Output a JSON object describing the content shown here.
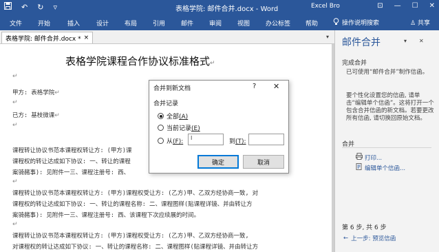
{
  "titlebar": {
    "save_icon": "save-icon",
    "undo_icon": "undo-icon",
    "redo_icon": "redo-icon",
    "qat_menu": "▿",
    "title": "表格学院: 邮件合并.docx - Word",
    "user": "Excel Bro",
    "minimize": "—",
    "restore": "☐",
    "close": "✕",
    "ribbon_opts": "⊡"
  },
  "ribbon": {
    "tabs": [
      "文件",
      "开始",
      "插入",
      "设计",
      "布局",
      "引用",
      "邮件",
      "审阅",
      "视图",
      "办公标签",
      "帮助"
    ],
    "help_search": "操作说明搜索",
    "share": "共享"
  },
  "doc_tab": {
    "label": "表格学院: 邮件合并.docx *",
    "close": "×",
    "dropdown": "▾"
  },
  "document": {
    "heading": "表格学院课程合作协议标准格式",
    "pilcrow": "↵",
    "party_a": "甲方: 表格学院",
    "party_b": "已方: 基枝微课",
    "para1": [
      "课程转让协议书范本课程权转让方: (甲方)课",
      "课程权的转让达成如下协议: 一、转让的课程",
      "案骑赭事): 见附件一三、课程注册号: 西、"
    ],
    "para2": [
      "课程转让协议书范本课程权转让方: (甲方)课程权受让方: (乙方)甲、乙双方经协商一致, 对",
      "课程权的转让达成如下协议: 一、转让的课程名称: 二、课程图样(贴课程详镜、并由转让方",
      "案骑赭事): 见附件一三、课程注册号: 西、该课程下次应续展的时间。"
    ],
    "para3": [
      "课程转让协议书范本课程权转让方: (甲方)课程权受让方: (乙方)甲、乙双方经协商一致,",
      "对课程权的转让达成如下协议: 一、转让的课程名称: 二、课程图样(贴课程详镜、并由转让方"
    ]
  },
  "dialog": {
    "title": "合并到新文档",
    "help": "?",
    "close": "✕",
    "group": "合并记录",
    "opt_all": "全部",
    "opt_all_key": "(A)",
    "opt_current": "当前记录",
    "opt_current_key": "(E)",
    "opt_from": "从",
    "opt_from_key": "(F):",
    "to_label": "到",
    "to_key": "(T):",
    "from_value": "I",
    "to_value": "",
    "ok": "确定",
    "cancel": "取消",
    "selected": "all"
  },
  "pane": {
    "title": "邮件合并",
    "dropdown": "▾",
    "close": "✕",
    "sec_complete": "完成合并",
    "complete_text": "已可使用“邮件合并”制作信函。",
    "personalize_text": "要个性化设置您的信函, 请单击“编辑单个信函”。这将打开一个包含合并信函的新文档。若要更改所有信函, 请切换回原始文档。",
    "sec_merge": "合并",
    "print_link": "打印...",
    "edit_link": "编辑单个信函...",
    "step": "第 6 步, 共 6 步",
    "prev_link": "上一步: 预览信函"
  },
  "colors": {
    "accent": "#2b579a",
    "primary_button_border": "#0078d7"
  }
}
